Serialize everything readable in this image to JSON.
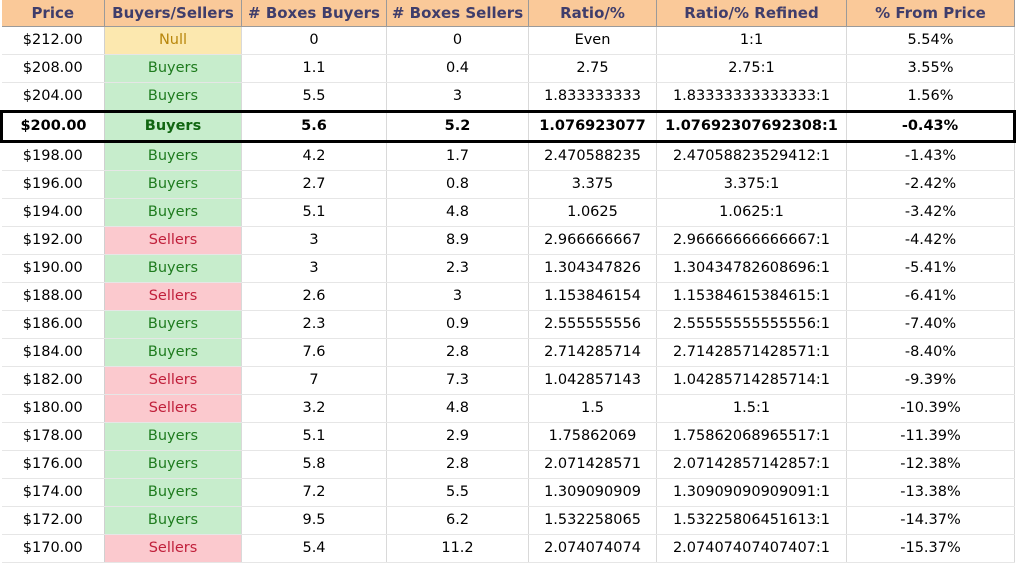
{
  "table": {
    "columns": [
      {
        "key": "price",
        "label": "Price"
      },
      {
        "key": "signal",
        "label": "Buyers/Sellers"
      },
      {
        "key": "boxes_buy",
        "label": "# Boxes Buyers"
      },
      {
        "key": "boxes_sell",
        "label": "# Boxes Sellers"
      },
      {
        "key": "ratio",
        "label": "Ratio/%"
      },
      {
        "key": "ratio_ref",
        "label": "Ratio/% Refined"
      },
      {
        "key": "pct_price",
        "label": "% From Price"
      }
    ],
    "colors": {
      "header_bg": "#FAC999",
      "header_text": "#3F3D6B",
      "buyers_bg": "#C7EDCC",
      "buyers_text": "#1E7B1E",
      "sellers_bg": "#FBC9CE",
      "sellers_text": "#C0203B",
      "null_bg": "#FCE8AF",
      "null_text": "#B8860B",
      "highlight_border": "#000000"
    },
    "highlight_row_index": 3,
    "rows": [
      {
        "price": "$212.00",
        "signal": "Null",
        "boxes_buy": "0",
        "boxes_sell": "0",
        "ratio": "Even",
        "ratio_ref": "1:1",
        "pct_price": "5.54%"
      },
      {
        "price": "$208.00",
        "signal": "Buyers",
        "boxes_buy": "1.1",
        "boxes_sell": "0.4",
        "ratio": "2.75",
        "ratio_ref": "2.75:1",
        "pct_price": "3.55%"
      },
      {
        "price": "$204.00",
        "signal": "Buyers",
        "boxes_buy": "5.5",
        "boxes_sell": "3",
        "ratio": "1.833333333",
        "ratio_ref": "1.83333333333333:1",
        "pct_price": "1.56%"
      },
      {
        "price": "$200.00",
        "signal": "Buyers",
        "boxes_buy": "5.6",
        "boxes_sell": "5.2",
        "ratio": "1.076923077",
        "ratio_ref": "1.07692307692308:1",
        "pct_price": "-0.43%"
      },
      {
        "price": "$198.00",
        "signal": "Buyers",
        "boxes_buy": "4.2",
        "boxes_sell": "1.7",
        "ratio": "2.470588235",
        "ratio_ref": "2.47058823529412:1",
        "pct_price": "-1.43%"
      },
      {
        "price": "$196.00",
        "signal": "Buyers",
        "boxes_buy": "2.7",
        "boxes_sell": "0.8",
        "ratio": "3.375",
        "ratio_ref": "3.375:1",
        "pct_price": "-2.42%"
      },
      {
        "price": "$194.00",
        "signal": "Buyers",
        "boxes_buy": "5.1",
        "boxes_sell": "4.8",
        "ratio": "1.0625",
        "ratio_ref": "1.0625:1",
        "pct_price": "-3.42%"
      },
      {
        "price": "$192.00",
        "signal": "Sellers",
        "boxes_buy": "3",
        "boxes_sell": "8.9",
        "ratio": "2.966666667",
        "ratio_ref": "2.96666666666667:1",
        "pct_price": "-4.42%"
      },
      {
        "price": "$190.00",
        "signal": "Buyers",
        "boxes_buy": "3",
        "boxes_sell": "2.3",
        "ratio": "1.304347826",
        "ratio_ref": "1.30434782608696:1",
        "pct_price": "-5.41%"
      },
      {
        "price": "$188.00",
        "signal": "Sellers",
        "boxes_buy": "2.6",
        "boxes_sell": "3",
        "ratio": "1.153846154",
        "ratio_ref": "1.15384615384615:1",
        "pct_price": "-6.41%"
      },
      {
        "price": "$186.00",
        "signal": "Buyers",
        "boxes_buy": "2.3",
        "boxes_sell": "0.9",
        "ratio": "2.555555556",
        "ratio_ref": "2.55555555555556:1",
        "pct_price": "-7.40%"
      },
      {
        "price": "$184.00",
        "signal": "Buyers",
        "boxes_buy": "7.6",
        "boxes_sell": "2.8",
        "ratio": "2.714285714",
        "ratio_ref": "2.71428571428571:1",
        "pct_price": "-8.40%"
      },
      {
        "price": "$182.00",
        "signal": "Sellers",
        "boxes_buy": "7",
        "boxes_sell": "7.3",
        "ratio": "1.042857143",
        "ratio_ref": "1.04285714285714:1",
        "pct_price": "-9.39%"
      },
      {
        "price": "$180.00",
        "signal": "Sellers",
        "boxes_buy": "3.2",
        "boxes_sell": "4.8",
        "ratio": "1.5",
        "ratio_ref": "1.5:1",
        "pct_price": "-10.39%"
      },
      {
        "price": "$178.00",
        "signal": "Buyers",
        "boxes_buy": "5.1",
        "boxes_sell": "2.9",
        "ratio": "1.75862069",
        "ratio_ref": "1.75862068965517:1",
        "pct_price": "-11.39%"
      },
      {
        "price": "$176.00",
        "signal": "Buyers",
        "boxes_buy": "5.8",
        "boxes_sell": "2.8",
        "ratio": "2.071428571",
        "ratio_ref": "2.07142857142857:1",
        "pct_price": "-12.38%"
      },
      {
        "price": "$174.00",
        "signal": "Buyers",
        "boxes_buy": "7.2",
        "boxes_sell": "5.5",
        "ratio": "1.309090909",
        "ratio_ref": "1.30909090909091:1",
        "pct_price": "-13.38%"
      },
      {
        "price": "$172.00",
        "signal": "Buyers",
        "boxes_buy": "9.5",
        "boxes_sell": "6.2",
        "ratio": "1.532258065",
        "ratio_ref": "1.53225806451613:1",
        "pct_price": "-14.37%"
      },
      {
        "price": "$170.00",
        "signal": "Sellers",
        "boxes_buy": "5.4",
        "boxes_sell": "11.2",
        "ratio": "2.074074074",
        "ratio_ref": "2.07407407407407:1",
        "pct_price": "-15.37%"
      }
    ]
  }
}
